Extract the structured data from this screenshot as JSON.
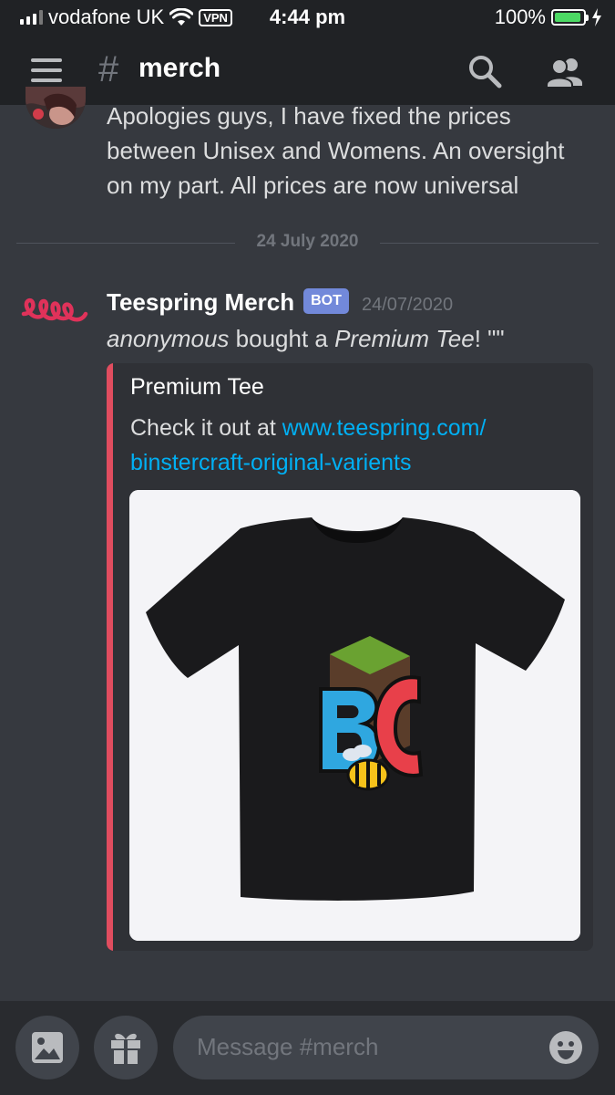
{
  "status_bar": {
    "carrier": "vodafone UK",
    "vpn": "VPN",
    "time": "4:44 pm",
    "battery": "100%",
    "battery_level": 1.0,
    "signal_bars": 3
  },
  "header": {
    "channel_prefix": "#",
    "channel_name": "merch",
    "icons": [
      "menu-icon",
      "search-icon",
      "members-icon"
    ]
  },
  "messages": [
    {
      "text_lines": [
        "Apologies guys, I have fixed the prices",
        "between Unisex and Womens. An oversight",
        "on my part. All prices are now universal"
      ]
    }
  ],
  "date_divider": "24 July 2020",
  "bot_message": {
    "author": "Teespring Merch",
    "tag": "BOT",
    "timestamp": "24/07/2020",
    "text_parts": {
      "buyer": "anonymous",
      "middle": " bought a ",
      "product": "Premium Tee",
      "suffix": "! \"\""
    },
    "embed": {
      "title": "Premium Tee",
      "desc_prefix": "Check it out at ",
      "link_line1": "www.teespring.com/",
      "link_line2": "binstercraft-original-varients",
      "accent_color": "#e04d5f"
    }
  },
  "composer": {
    "placeholder": "Message #merch",
    "buttons": [
      "image-icon",
      "gift-icon",
      "emoji-icon"
    ]
  },
  "colors": {
    "background": "#36393f",
    "header": "#202225",
    "link": "#00b0f4",
    "bot_tag": "#7289da"
  }
}
